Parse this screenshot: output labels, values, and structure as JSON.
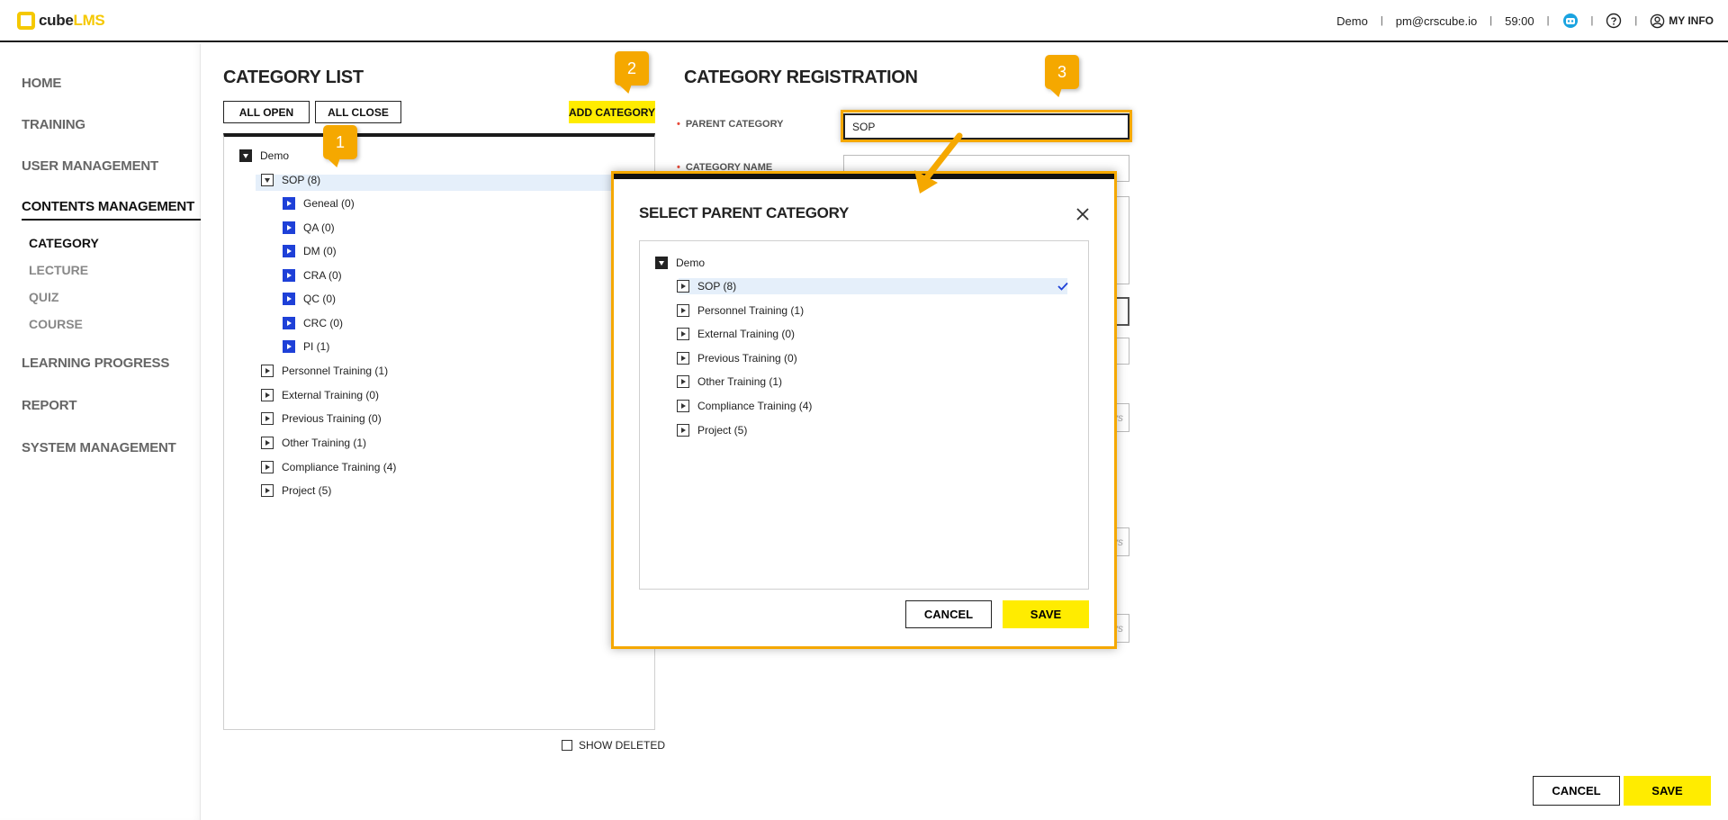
{
  "app": {
    "logo_cube": "cube",
    "logo_lms": "LMS"
  },
  "header": {
    "tenant": "Demo",
    "email": "pm@crscube.io",
    "timer": "59:00",
    "my_info": "MY INFO",
    "icons": [
      "chatbot-icon",
      "help-icon",
      "user-icon"
    ]
  },
  "sidebar": {
    "items": [
      {
        "label": "HOME"
      },
      {
        "label": "TRAINING"
      },
      {
        "label": "USER MANAGEMENT"
      },
      {
        "label": "CONTENTS MANAGEMENT"
      },
      {
        "label": "LEARNING PROGRESS"
      },
      {
        "label": "REPORT"
      },
      {
        "label": "SYSTEM MANAGEMENT"
      }
    ],
    "sub_items": [
      {
        "label": "CATEGORY"
      },
      {
        "label": "LECTURE"
      },
      {
        "label": "QUIZ"
      },
      {
        "label": "COURSE"
      }
    ]
  },
  "category_list": {
    "title": "CATEGORY LIST",
    "all_open": "ALL OPEN",
    "all_close": "ALL CLOSE",
    "add_category": "ADD CATEGORY",
    "show_deleted": "SHOW DELETED",
    "tree": {
      "root": "Demo",
      "sop": "SOP (8)",
      "sop_children": [
        "Geneal (0)",
        "QA (0)",
        "DM (0)",
        "CRA (0)",
        "QC (0)",
        "CRC (0)",
        "PI (1)"
      ],
      "siblings": [
        "Personnel Training (1)",
        "External Training (0)",
        "Previous Training (0)",
        "Other Training (1)",
        "Compliance Training (4)",
        "Project (5)"
      ]
    }
  },
  "registration": {
    "title": "CATEGORY REGISTRATION",
    "parent_label": "PARENT CATEGORY",
    "parent_value": "SOP",
    "name_label": "CATEGORY NAME",
    "ghost_text": "ys"
  },
  "modal": {
    "title": "SELECT PARENT CATEGORY",
    "root": "Demo",
    "items": [
      "SOP (8)",
      "Personnel Training (1)",
      "External Training (0)",
      "Previous Training (0)",
      "Other Training (1)",
      "Compliance Training (4)",
      "Project (5)"
    ],
    "cancel": "CANCEL",
    "save": "SAVE"
  },
  "footer": {
    "cancel": "CANCEL",
    "save": "SAVE"
  },
  "callouts": [
    "1",
    "2",
    "3"
  ],
  "colors": {
    "accent_yellow": "#ffec00",
    "callout_orange": "#f5a800",
    "tree_blue": "#1e40d8",
    "selected_row": "#e5effa",
    "required_red": "#e84a3a"
  }
}
